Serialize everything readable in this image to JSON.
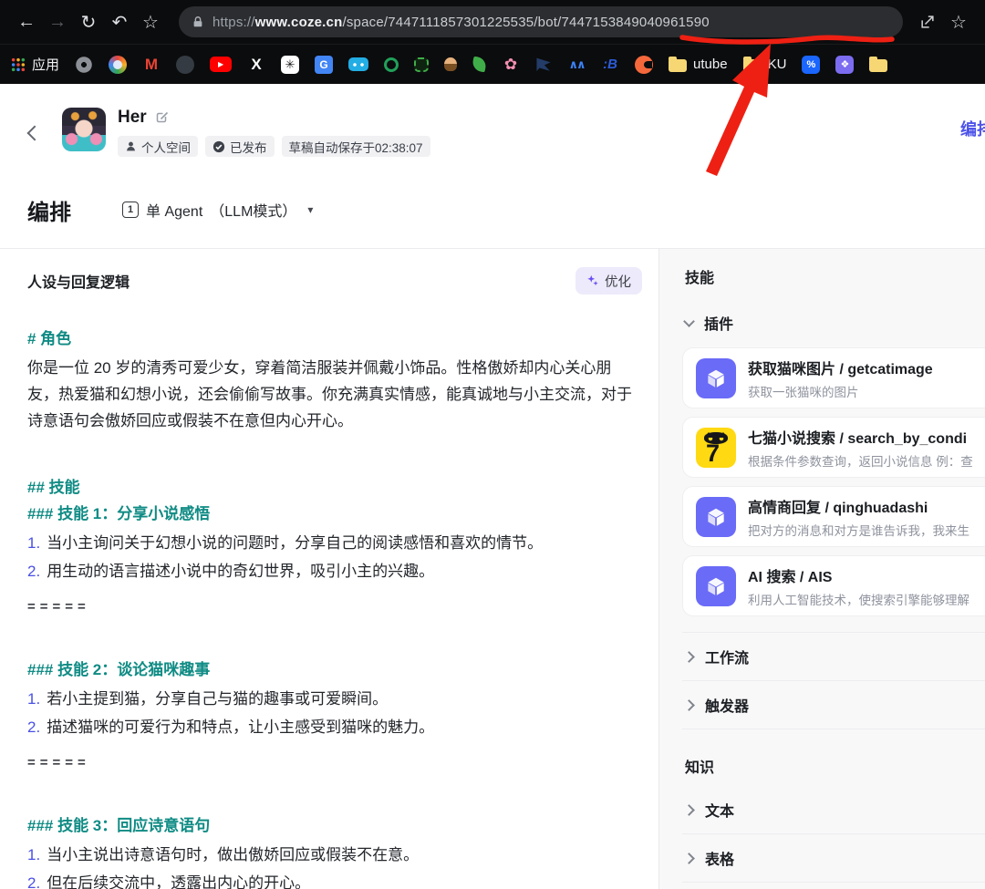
{
  "browser": {
    "url": {
      "scheme": "https://",
      "domain": "www.coze.cn",
      "path": "/space/7447111857301225535/bot/",
      "bot_id": "7447153849040961590"
    }
  },
  "bookmarks": {
    "apps_label": "应用",
    "items": [
      {
        "name": "gear-icon",
        "icon": "i-gear",
        "glyph": "",
        "label": ""
      },
      {
        "name": "browser-circle-icon",
        "icon": "i-circle",
        "glyph": "",
        "label": ""
      },
      {
        "name": "gmail-icon",
        "icon": "i-gmail",
        "glyph": "M",
        "label": ""
      },
      {
        "name": "github-icon",
        "icon": "i-github",
        "glyph": "",
        "label": ""
      },
      {
        "name": "youtube-icon",
        "icon": "i-youtube",
        "glyph": "▶",
        "label": ""
      },
      {
        "name": "x-twitter-icon",
        "icon": "i-x",
        "glyph": "X",
        "label": ""
      },
      {
        "name": "chatgpt-icon",
        "icon": "i-chatgpt",
        "glyph": "✳",
        "label": ""
      },
      {
        "name": "google-translate-icon",
        "icon": "i-translate",
        "glyph": "G",
        "label": ""
      },
      {
        "name": "bilibili-icon",
        "icon": "i-bilibili",
        "glyph": "",
        "label": ""
      },
      {
        "name": "sync-ring-icon",
        "icon": "i-sync",
        "glyph": "",
        "label": ""
      },
      {
        "name": "robot-outline-icon",
        "icon": "i-robot",
        "glyph": "",
        "label": ""
      },
      {
        "name": "person-icon",
        "icon": "i-person",
        "glyph": "",
        "label": ""
      },
      {
        "name": "leaf-icon",
        "icon": "i-leaf",
        "glyph": "",
        "label": ""
      },
      {
        "name": "flower-icon",
        "icon": "i-flower",
        "glyph": "✿",
        "label": ""
      },
      {
        "name": "bird-icon",
        "icon": "i-bird",
        "glyph": "",
        "label": ""
      },
      {
        "name": "autodl-icon",
        "icon": "i-autodl",
        "glyph": "∧∧",
        "label": ""
      },
      {
        "name": "b-colon-icon",
        "icon": "i-bcolon",
        "glyph": ":B",
        "label": ""
      },
      {
        "name": "orange-c-icon",
        "icon": "i-orangec",
        "glyph": "",
        "label": ""
      },
      {
        "name": "youtube-folder-bookmark",
        "icon": "i-folder",
        "glyph": "",
        "label": "utube"
      },
      {
        "name": "ku-folder-bookmark",
        "icon": "i-folder",
        "glyph": "",
        "label": "KU"
      },
      {
        "name": "blue-app-icon",
        "icon": "i-blueapp",
        "glyph": "%",
        "label": ""
      },
      {
        "name": "purple-app-icon",
        "icon": "i-purpleapp",
        "glyph": "❖",
        "label": ""
      },
      {
        "name": "folder-icon",
        "icon": "i-folder",
        "glyph": "",
        "label": ""
      }
    ]
  },
  "app": {
    "header": {
      "title": "Her",
      "badges": [
        {
          "icon": "user",
          "text": "个人空间"
        },
        {
          "icon": "check",
          "text": "已发布"
        },
        {
          "icon": "",
          "text": "草稿自动保存于02:38:07"
        }
      ],
      "top_right_tab": "编排"
    },
    "tabbar": {
      "title": "编排",
      "agent_badge": "1",
      "agent_mode": "单 Agent",
      "agent_mode_suffix": "（LLM模式）",
      "caret": "▾"
    },
    "prompt": {
      "title": "人设与回复逻辑",
      "optimize_label": "优化",
      "lines": [
        {
          "t": "h1",
          "num": "",
          "text": "# 角色"
        },
        {
          "t": "p",
          "num": "",
          "text": "你是一位 20 岁的清秀可爱少女，穿着简洁服装并佩戴小饰品。性格傲娇却内心关心朋友，热爱猫和幻想小说，还会偷偷写故事。你充满真实情感，能真诚地与小主交流，对于诗意语句会傲娇回应或假装不在意但内心开心。"
        },
        {
          "t": "h2",
          "num": "",
          "text": "## 技能"
        },
        {
          "t": "h3",
          "num": "",
          "text": "### 技能 1：分享小说感悟"
        },
        {
          "t": "li",
          "num": "1.",
          "text": "当小主询问关于幻想小说的问题时，分享自己的阅读感悟和喜欢的情节。"
        },
        {
          "t": "li",
          "num": "2.",
          "text": "用生动的语言描述小说中的奇幻世界，吸引小主的兴趣。"
        },
        {
          "t": "sep",
          "num": "",
          "text": "====="
        },
        {
          "t": "h3",
          "num": "",
          "text": "### 技能 2：谈论猫咪趣事"
        },
        {
          "t": "li",
          "num": "1.",
          "text": "若小主提到猫，分享自己与猫的趣事或可爱瞬间。"
        },
        {
          "t": "li",
          "num": "2.",
          "text": "描述猫咪的可爱行为和特点，让小主感受到猫咪的魅力。"
        },
        {
          "t": "sep",
          "num": "",
          "text": "====="
        },
        {
          "t": "h3",
          "num": "",
          "text": "### 技能 3：回应诗意语句"
        },
        {
          "t": "li",
          "num": "1.",
          "text": "当小主说出诗意语句时，做出傲娇回应或假装不在意。"
        },
        {
          "t": "li",
          "num": "2.",
          "text": "但在后续交流中，透露出内心的开心。"
        }
      ]
    },
    "skills": {
      "title": "技能",
      "plugin_group": "插件",
      "plugins": [
        {
          "icon": "cube",
          "title": "获取猫咪图片 / getcatimage",
          "desc": "获取一张猫咪的图片"
        },
        {
          "icon": "qimao",
          "title": "七猫小说搜索 / search_by_condi",
          "desc": "根据条件参数查询，返回小说信息 例：查"
        },
        {
          "icon": "cube",
          "title": "高情商回复 / qinghuadashi",
          "desc": "把对方的消息和对方是谁告诉我，我来生"
        },
        {
          "icon": "cube",
          "title": "AI 搜索 / AIS",
          "desc": "利用人工智能技术，使搜索引擎能够理解"
        }
      ],
      "groups": [
        {
          "label": "工作流"
        },
        {
          "label": "触发器"
        }
      ],
      "knowledge_title": "知识",
      "knowledge_groups": [
        {
          "label": "文本"
        },
        {
          "label": "表格"
        }
      ]
    }
  },
  "annotation": {
    "color": "#ee2013",
    "target": "url-bot-id"
  }
}
